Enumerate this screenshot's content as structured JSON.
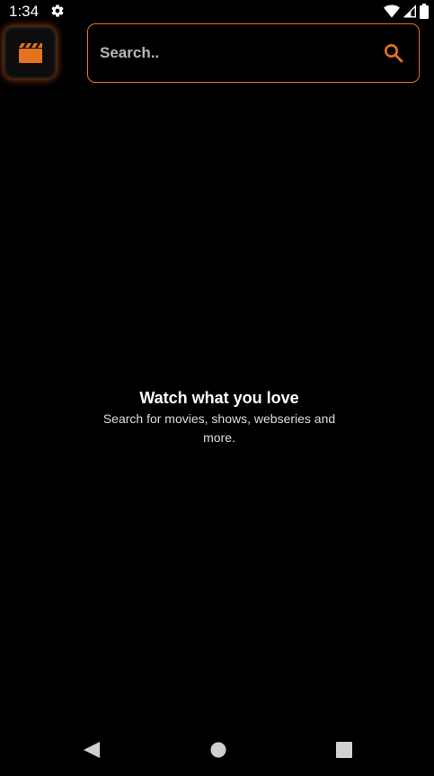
{
  "status_bar": {
    "time": "1:34",
    "icons": [
      "settings-gear-icon",
      "wifi-icon",
      "cell-signal-icon",
      "battery-icon"
    ]
  },
  "header": {
    "logo_icon": "clapperboard-icon",
    "search": {
      "placeholder": "Search..",
      "value": "",
      "icon": "search-icon"
    }
  },
  "empty_state": {
    "title": "Watch what you love",
    "subtitle": "Search for movies, shows, webseries and more."
  },
  "nav_bar": {
    "buttons": [
      "back-icon",
      "home-icon",
      "recents-icon"
    ]
  },
  "colors": {
    "accent": "#e3731f",
    "background": "#000000",
    "text": "#ffffff",
    "muted_text": "#dcdcdc"
  }
}
